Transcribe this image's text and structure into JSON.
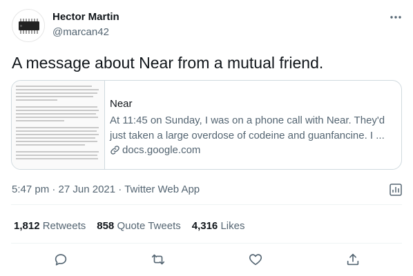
{
  "author": {
    "name": "Hector Martin",
    "handle": "@marcan42",
    "avatar_icon": "chip-icon"
  },
  "tweet": {
    "text": "A message about Near from a mutual friend.",
    "time": "5:47 pm",
    "date": "27 Jun 2021",
    "separator": "·",
    "source": "Twitter Web App"
  },
  "card": {
    "title": "Near",
    "description": "At 11:45 on Sunday, I was on a phone call with Near. They'd just taken a large overdose of codeine and guanfancine. I ...",
    "domain": "docs.google.com"
  },
  "stats": {
    "retweets_count": "1,812",
    "retweets_label": "Retweets",
    "quotes_count": "858",
    "quotes_label": "Quote Tweets",
    "likes_count": "4,316",
    "likes_label": "Likes"
  },
  "colors": {
    "text_primary": "#0f1419",
    "text_secondary": "#536471",
    "border": "#cfd9de"
  }
}
